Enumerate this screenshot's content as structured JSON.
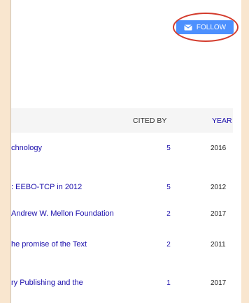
{
  "profile": {
    "follow_label": "FOLLOW"
  },
  "table": {
    "header": {
      "cited_by": "CITED BY",
      "year": "YEAR"
    },
    "rows": [
      {
        "title": "chnology",
        "cited_by": "5",
        "year": "2016"
      },
      {
        "title": ": EEBO-TCP in 2012",
        "cited_by": "5",
        "year": "2012"
      },
      {
        "title": "Andrew W. Mellon Foundation",
        "cited_by": "2",
        "year": "2017"
      },
      {
        "title": "he promise of the Text",
        "cited_by": "2",
        "year": "2011"
      },
      {
        "title": "ry Publishing and the",
        "cited_by": "1",
        "year": "2017"
      }
    ]
  },
  "colors": {
    "background": "#f9e6cf",
    "follow_button": "#4d90fe",
    "highlight_ring": "#d33b2c",
    "link": "#1a0dab"
  },
  "icons": {
    "follow": "envelope-icon"
  }
}
